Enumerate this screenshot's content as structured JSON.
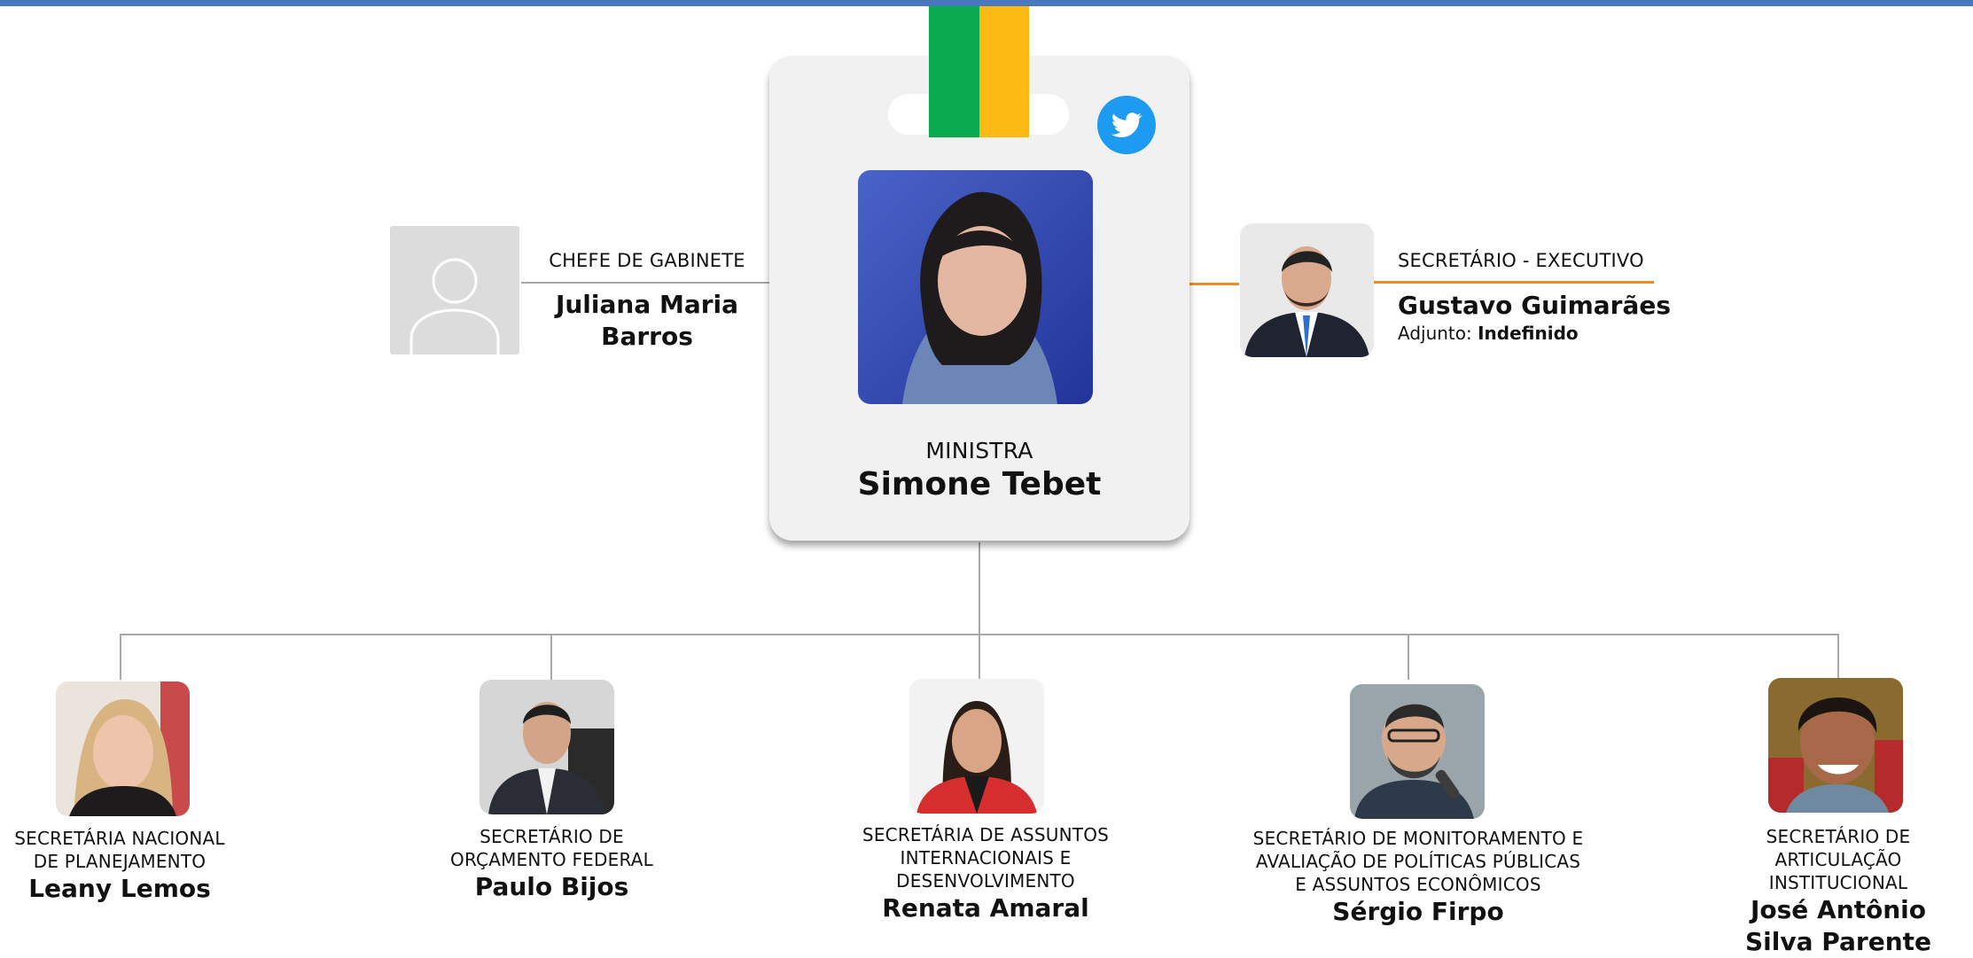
{
  "colors": {
    "top_bar": "#4a78be",
    "lanyard_green": "#0aa84f",
    "lanyard_yellow": "#fdb913",
    "twitter": "#1d9bf0",
    "connector_executive": "#f08a24",
    "card": "#f1f1f1"
  },
  "minister": {
    "role": "MINISTRA",
    "name": "Simone Tebet",
    "social_icon": "twitter-icon"
  },
  "chief_of_staff": {
    "role": "CHEFE DE GABINETE",
    "name": "Juliana Maria Barros",
    "photo": "placeholder-avatar-icon"
  },
  "executive_secretary": {
    "role": "SECRETÁRIO - EXECUTIVO",
    "name": "Gustavo Guimarães",
    "deputy_label": "Adjunto:",
    "deputy_value": "Indefinido"
  },
  "secretaries": [
    {
      "role": "SECRETÁRIA NACIONAL DE PLANEJAMENTO",
      "name": "Leany Lemos"
    },
    {
      "role": "SECRETÁRIO DE ORÇAMENTO FEDERAL",
      "name": "Paulo Bijos"
    },
    {
      "role": "SECRETÁRIA DE ASSUNTOS INTERNACIONAIS E DESENVOLVIMENTO",
      "name": "Renata Amaral"
    },
    {
      "role": "SECRETÁRIO DE MONITORAMENTO E AVALIAÇÃO DE POLÍTICAS PÚBLICAS E ASSUNTOS ECONÔMICOS",
      "name": "Sérgio Firpo"
    },
    {
      "role": "SECRETÁRIO DE ARTICULAÇÃO INSTITUCIONAL",
      "name": "José Antônio Silva Parente"
    }
  ]
}
